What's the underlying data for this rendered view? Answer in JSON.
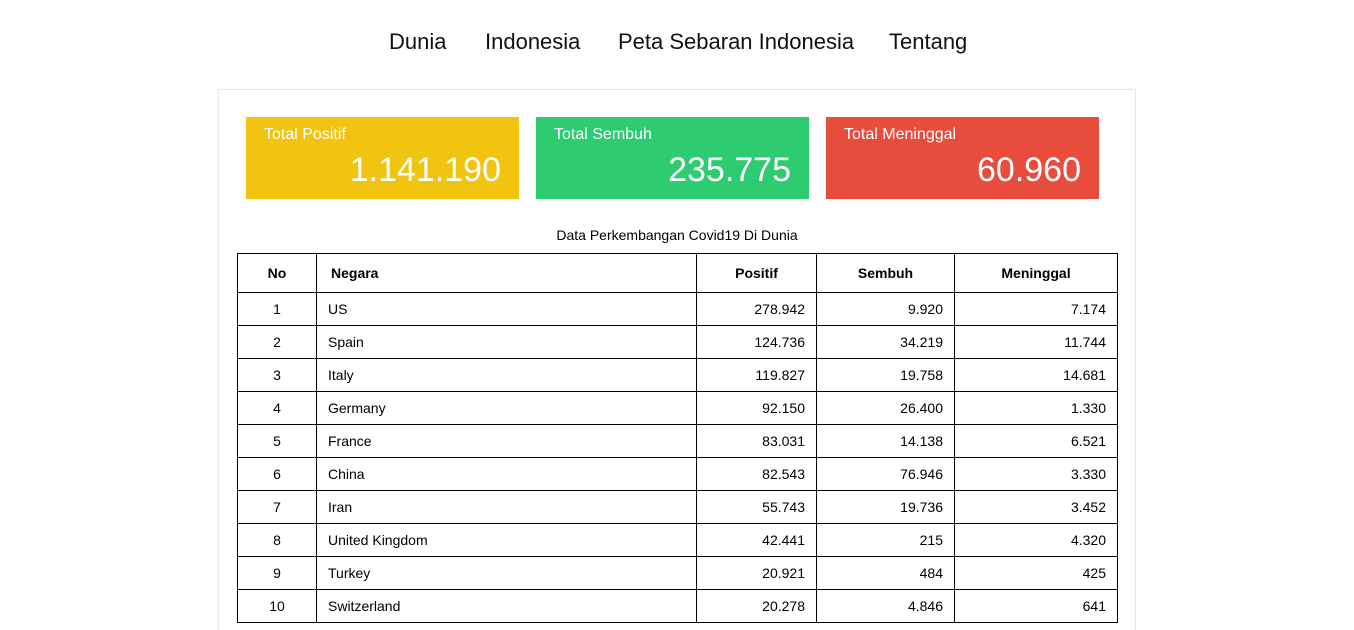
{
  "nav": {
    "items": [
      "Dunia",
      "Indonesia",
      "Peta Sebaran Indonesia",
      "Tentang"
    ]
  },
  "stats": {
    "positif": {
      "label": "Total Positif",
      "value": "1.141.190",
      "color": "#f1c40f"
    },
    "sembuh": {
      "label": "Total Sembuh",
      "value": "235.775",
      "color": "#2ecc71"
    },
    "meninggal": {
      "label": "Total Meninggal",
      "value": "60.960",
      "color": "#e74c3c"
    }
  },
  "table": {
    "caption": "Data Perkembangan Covid19 Di Dunia",
    "headers": {
      "no": "No",
      "negara": "Negara",
      "positif": "Positif",
      "sembuh": "Sembuh",
      "meninggal": "Meninggal"
    },
    "rows": [
      {
        "no": "1",
        "negara": "US",
        "positif": "278.942",
        "sembuh": "9.920",
        "meninggal": "7.174"
      },
      {
        "no": "2",
        "negara": "Spain",
        "positif": "124.736",
        "sembuh": "34.219",
        "meninggal": "11.744"
      },
      {
        "no": "3",
        "negara": "Italy",
        "positif": "119.827",
        "sembuh": "19.758",
        "meninggal": "14.681"
      },
      {
        "no": "4",
        "negara": "Germany",
        "positif": "92.150",
        "sembuh": "26.400",
        "meninggal": "1.330"
      },
      {
        "no": "5",
        "negara": "France",
        "positif": "83.031",
        "sembuh": "14.138",
        "meninggal": "6.521"
      },
      {
        "no": "6",
        "negara": "China",
        "positif": "82.543",
        "sembuh": "76.946",
        "meninggal": "3.330"
      },
      {
        "no": "7",
        "negara": "Iran",
        "positif": "55.743",
        "sembuh": "19.736",
        "meninggal": "3.452"
      },
      {
        "no": "8",
        "negara": "United Kingdom",
        "positif": "42.441",
        "sembuh": "215",
        "meninggal": "4.320"
      },
      {
        "no": "9",
        "negara": "Turkey",
        "positif": "20.921",
        "sembuh": "484",
        "meninggal": "425"
      },
      {
        "no": "10",
        "negara": "Switzerland",
        "positif": "20.278",
        "sembuh": "4.846",
        "meninggal": "641"
      }
    ]
  }
}
